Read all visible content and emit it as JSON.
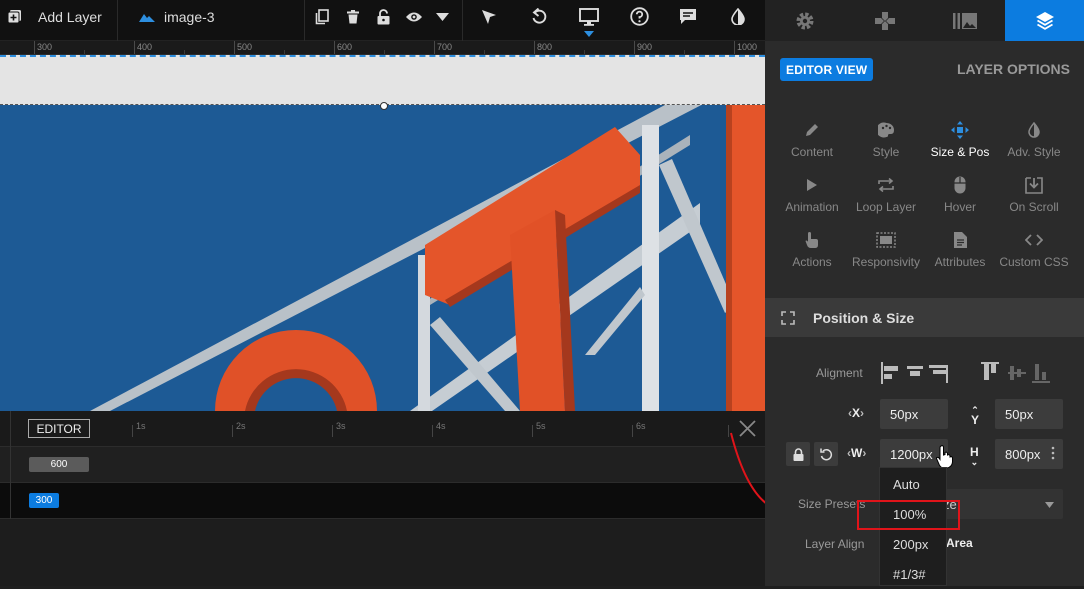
{
  "toolbar": {
    "add_layer": "Add Layer",
    "layer_name": "image-3",
    "icons": [
      "add-layer-icon",
      "image-layer-icon",
      "duplicate-icon",
      "trash-icon",
      "lock-icon",
      "eye-icon",
      "caret-down-icon",
      "pointer-icon",
      "undo-icon",
      "desktop-icon",
      "help-icon",
      "comment-icon",
      "contrast-icon"
    ]
  },
  "ruler": {
    "labels": [
      "300",
      "400",
      "500",
      "600",
      "700",
      "800",
      "900",
      "1000"
    ]
  },
  "timeline": {
    "editor_tab": "EDITOR",
    "time_labels": [
      "1s",
      "2s",
      "3s",
      "4s",
      "5s",
      "6s"
    ],
    "row1_value": "600",
    "row2_value": "300"
  },
  "panel": {
    "tabs": [
      "gear-icon",
      "gamepad-icon",
      "gallery-icon",
      "layers-icon"
    ],
    "editor_view": "EDITOR VIEW",
    "layer_options": "LAYER OPTIONS",
    "options": [
      {
        "label": "Content",
        "icon": "pencil-icon"
      },
      {
        "label": "Style",
        "icon": "palette-icon"
      },
      {
        "label": "Size & Pos",
        "icon": "move-icon"
      },
      {
        "label": "Adv. Style",
        "icon": "contrast-icon"
      },
      {
        "label": "Animation",
        "icon": "play-icon"
      },
      {
        "label": "Loop Layer",
        "icon": "loop-icon"
      },
      {
        "label": "Hover",
        "icon": "mouse-icon"
      },
      {
        "label": "On Scroll",
        "icon": "download-box-icon"
      },
      {
        "label": "Actions",
        "icon": "touch-icon"
      },
      {
        "label": "Responsivity",
        "icon": "responsive-icon"
      },
      {
        "label": "Attributes",
        "icon": "document-icon"
      },
      {
        "label": "Custom CSS",
        "icon": "code-icon"
      }
    ],
    "section_title": "Position & Size",
    "alignment_label": "Aligment",
    "x_label": "X",
    "x_value": "50px",
    "y_label": "Y",
    "y_value": "50px",
    "w_label": "W",
    "w_value": "1200px",
    "h_label": "H",
    "h_value": "800px",
    "size_presets_label": "Size Presets",
    "size_presets_value_fragment": "ze",
    "layer_align_label": "Layer Align",
    "layer_align_value_fragment": "Area"
  },
  "dropdown": {
    "items": [
      "Auto",
      "100%",
      "200px",
      "#1/3#"
    ],
    "highlighted": "100%"
  },
  "colors": {
    "accent": "#0c7ce0",
    "highlight": "#e0141a",
    "sky": "#1d5a95",
    "sign_orange": "#e4552a"
  }
}
